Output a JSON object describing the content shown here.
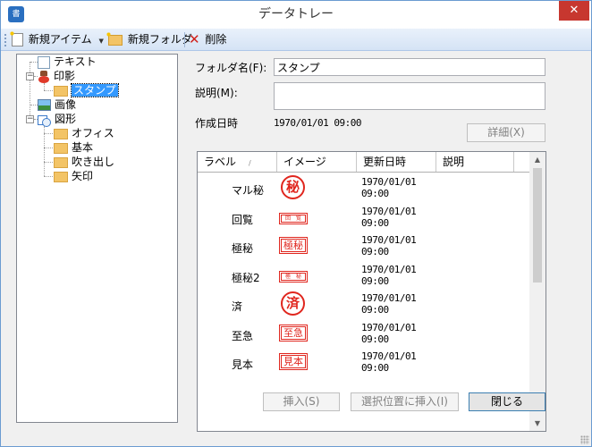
{
  "window": {
    "title": "データトレー",
    "app_icon_text": "書",
    "close_glyph": "✕"
  },
  "toolbar": {
    "new_item_label": "新規アイテム",
    "new_folder_label": "新規フォルダ",
    "delete_label": "削除"
  },
  "tree": {
    "text": "テキスト",
    "seal": "印影",
    "stamp": "スタンプ",
    "image": "画像",
    "shape": "図形",
    "shape_children": [
      "オフィス",
      "基本",
      "吹き出し",
      "矢印"
    ]
  },
  "form": {
    "folder_name_label": "フォルダ名(F):",
    "folder_name_value": "スタンプ",
    "description_label": "説明(M):",
    "description_value": "",
    "created_label": "作成日時",
    "created_value": "1970/01/01 09:00",
    "details_button": "詳細(X)"
  },
  "list": {
    "columns": [
      "ラベル",
      "イメージ",
      "更新日時",
      "説明"
    ],
    "sort_indicator": "/",
    "rows": [
      {
        "label": "マル秘",
        "image_text": "秘",
        "image_style": "circle",
        "date": "1970/01/01",
        "time": "09:00",
        "desc": ""
      },
      {
        "label": "回覧",
        "image_text": "回　覧",
        "image_style": "rect-small",
        "date": "1970/01/01",
        "time": "09:00",
        "desc": ""
      },
      {
        "label": "極秘",
        "image_text": "極秘",
        "image_style": "rect",
        "date": "1970/01/01",
        "time": "09:00",
        "desc": ""
      },
      {
        "label": "極秘2",
        "image_text": "極　秘",
        "image_style": "rect-small",
        "date": "1970/01/01",
        "time": "09:00",
        "desc": ""
      },
      {
        "label": "済",
        "image_text": "済",
        "image_style": "circle",
        "date": "1970/01/01",
        "time": "09:00",
        "desc": ""
      },
      {
        "label": "至急",
        "image_text": "至急",
        "image_style": "rect",
        "date": "1970/01/01",
        "time": "09:00",
        "desc": ""
      },
      {
        "label": "見本",
        "image_text": "見本",
        "image_style": "rect",
        "date": "1970/01/01",
        "time": "09:00",
        "desc": ""
      }
    ]
  },
  "buttons": {
    "insert": "挿入(S)",
    "insert_at": "選択位置に挿入(I)",
    "close": "閉じる"
  },
  "colors": {
    "stamp_red": "#e0261e",
    "selection": "#3399ff",
    "window_border": "#6b9bd1"
  }
}
